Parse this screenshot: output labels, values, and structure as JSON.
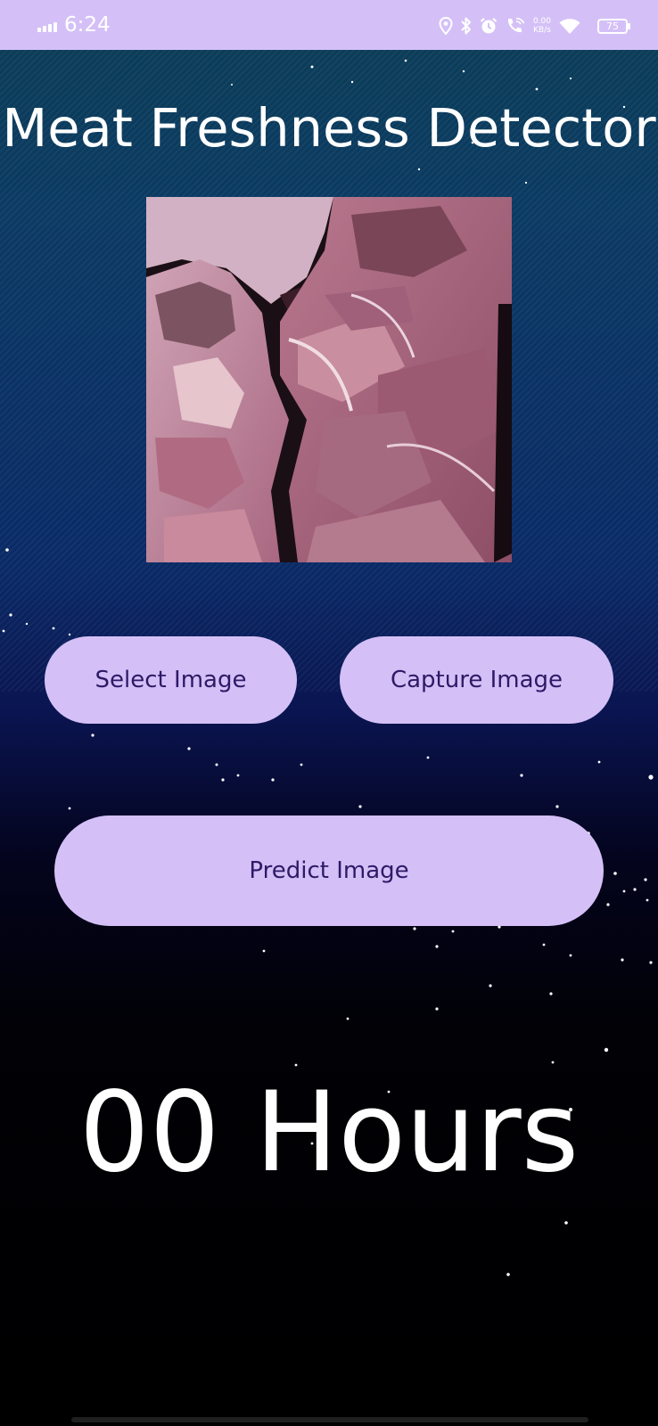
{
  "status_bar": {
    "time": "6:24",
    "net_speed_value": "0.00",
    "net_speed_unit": "KB/s",
    "battery_level": "75",
    "icons": [
      "signal-icon",
      "location-icon",
      "bluetooth-icon",
      "alarm-icon",
      "wifi-call-icon",
      "wifi-icon",
      "battery-icon"
    ]
  },
  "app": {
    "title": "Meat Freshness Detector",
    "preview_image": "raw-meat-photo"
  },
  "buttons": {
    "select_label": "Select Image",
    "capture_label": "Capture Image",
    "predict_label": "Predict Image"
  },
  "result": {
    "text": "00 Hours"
  },
  "colors": {
    "accent": "#d4c0f7",
    "button_text": "#2e1a66",
    "title_text": "#ffffff"
  }
}
